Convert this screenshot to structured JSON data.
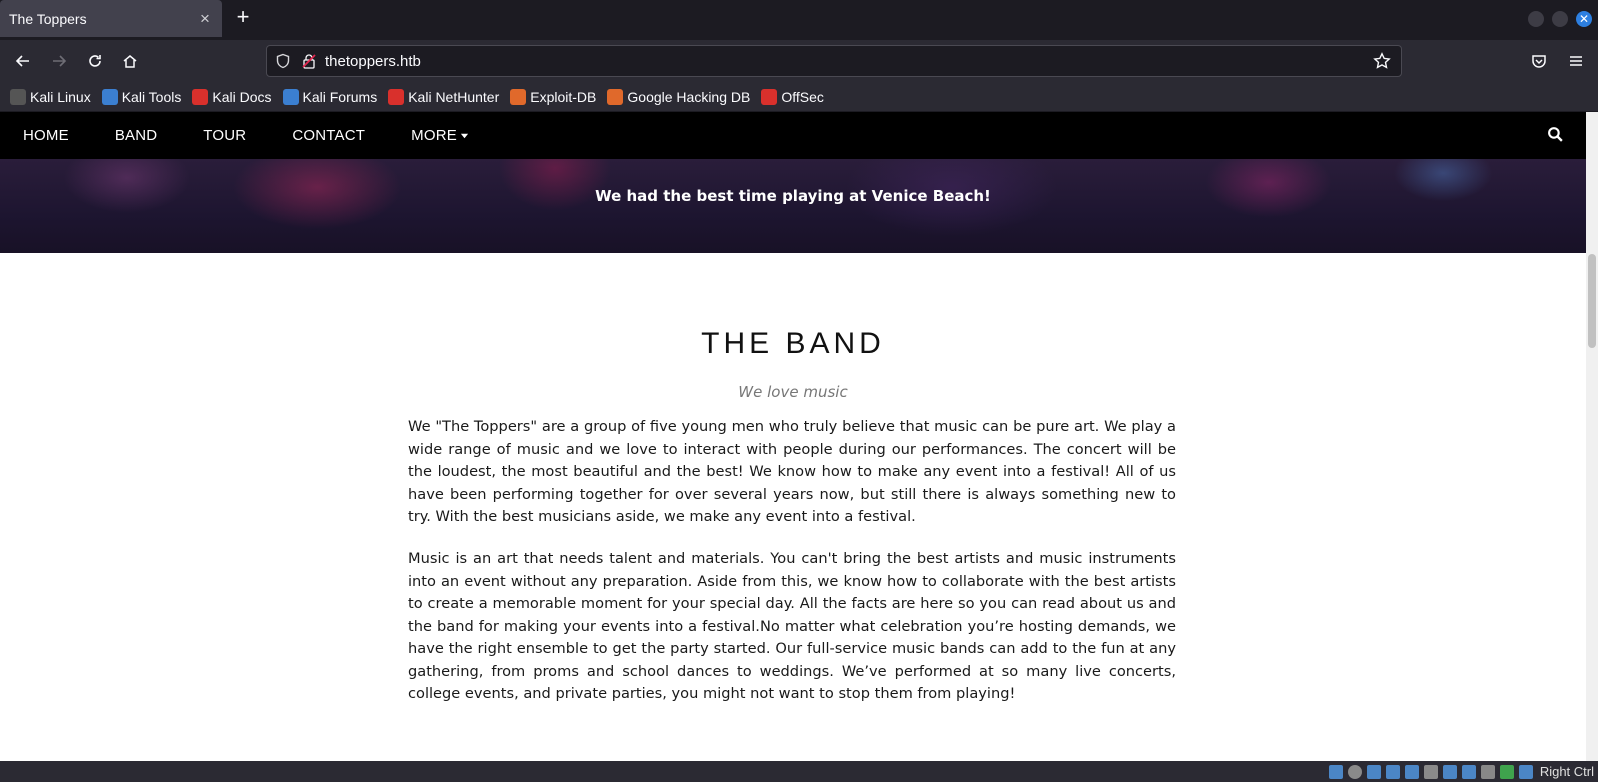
{
  "browser": {
    "tab_title": "The Toppers",
    "tab_close": "×",
    "new_tab": "+",
    "url": "thetoppers.htb",
    "bookmarks": [
      {
        "label": "Kali Linux",
        "color": "#2b2a33"
      },
      {
        "label": "Kali Tools",
        "color": "#3b7fd1"
      },
      {
        "label": "Kali Docs",
        "color": "#d9302c"
      },
      {
        "label": "Kali Forums",
        "color": "#3b7fd1"
      },
      {
        "label": "Kali NetHunter",
        "color": "#d9302c"
      },
      {
        "label": "Exploit-DB",
        "color": "#e0692b"
      },
      {
        "label": "Google Hacking DB",
        "color": "#e0692b"
      },
      {
        "label": "OffSec",
        "color": "#d9302c"
      }
    ]
  },
  "site": {
    "nav": [
      "HOME",
      "BAND",
      "TOUR",
      "CONTACT",
      "MORE"
    ],
    "hero_caption": "We had the best time playing at Venice Beach!",
    "band_title": "THE BAND",
    "band_subtitle": "We love music",
    "band_paragraphs": [
      "We \"The Toppers\" are a group of five young men who truly believe that music can be pure art. We play a wide range of music and we love to interact with people during our performances. The concert will be the loudest, the most beautiful and the best! We know how to make any event into a festival! All of us have been performing together for over several years now, but still there is always something new to try. With the best musicians aside, we make any event into a festival.",
      "Music is an art that needs talent and materials. You can't bring the best artists and music instruments into an event without any preparation. Aside from this, we know how to collaborate with the best artists to create a memorable moment for your special day. All the facts are here so you can read about us and the band for making your events into a festival.No matter what celebration you’re hosting demands, we have the right ensemble to get the party started. Our full-service music bands can add to the fun at any gathering, from proms and school dances to weddings. We’ve performed at so many live concerts, college events, and private parties, you might not want to stop them from playing!"
    ]
  },
  "os": {
    "status_text": "Right Ctrl"
  },
  "colors": {
    "accent": "#2d7fe0",
    "chrome": "#2b2a33",
    "site_nav": "#000000"
  }
}
